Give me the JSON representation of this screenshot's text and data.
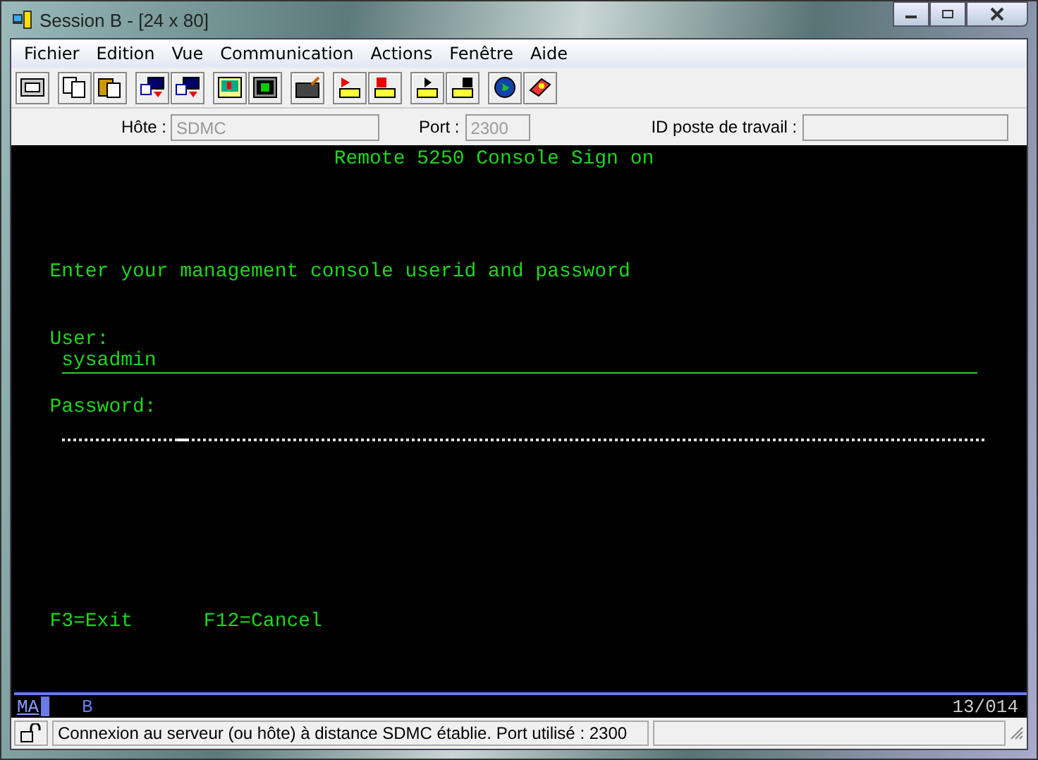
{
  "window": {
    "title": "Session B - [24 x 80]"
  },
  "menu": [
    "Fichier",
    "Edition",
    "Vue",
    "Communication",
    "Actions",
    "Fenêtre",
    "Aide"
  ],
  "connection": {
    "host_label": "Hôte :",
    "host": "SDMC",
    "port_label": "Port :",
    "port": "2300",
    "workstation_label": "ID poste de travail :"
  },
  "screen": {
    "title": "Remote 5250 Console Sign on",
    "prompt": "Enter your management console userid and password",
    "user_label": "User:",
    "user": "sysadmin",
    "password_label": "Password:",
    "keys": [
      "F3=Exit",
      "F12=Cancel"
    ]
  },
  "operator_line": {
    "mode": "MA",
    "session": "B",
    "position": "13/014"
  },
  "status_bar": {
    "message": "Connexion au serveur (ou hôte) à distance SDMC établie. Port utilisé : 2300"
  }
}
